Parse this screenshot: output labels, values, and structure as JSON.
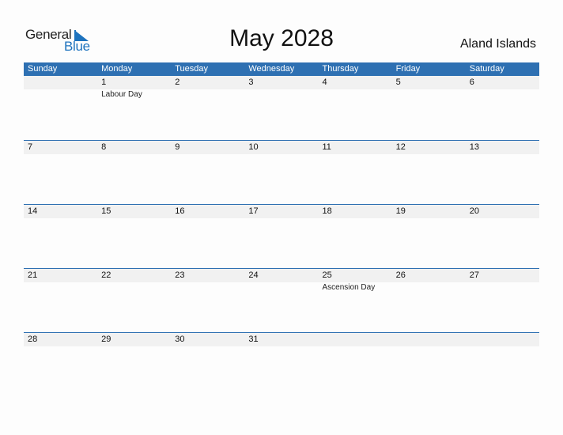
{
  "logo": {
    "general": "General",
    "blue": "Blue"
  },
  "title": "May 2028",
  "country": "Aland Islands",
  "colors": {
    "accent": "#2e70b2",
    "day_band": "#f1f1f1"
  },
  "weekdays": [
    "Sunday",
    "Monday",
    "Tuesday",
    "Wednesday",
    "Thursday",
    "Friday",
    "Saturday"
  ],
  "weeks": [
    {
      "days": [
        "",
        "1",
        "2",
        "3",
        "4",
        "5",
        "6"
      ],
      "events": [
        "",
        "Labour Day",
        "",
        "",
        "",
        "",
        ""
      ]
    },
    {
      "days": [
        "7",
        "8",
        "9",
        "10",
        "11",
        "12",
        "13"
      ],
      "events": [
        "",
        "",
        "",
        "",
        "",
        "",
        ""
      ]
    },
    {
      "days": [
        "14",
        "15",
        "16",
        "17",
        "18",
        "19",
        "20"
      ],
      "events": [
        "",
        "",
        "",
        "",
        "",
        "",
        ""
      ]
    },
    {
      "days": [
        "21",
        "22",
        "23",
        "24",
        "25",
        "26",
        "27"
      ],
      "events": [
        "",
        "",
        "",
        "",
        "Ascension Day",
        "",
        ""
      ]
    },
    {
      "days": [
        "28",
        "29",
        "30",
        "31",
        "",
        "",
        ""
      ],
      "events": [
        "",
        "",
        "",
        "",
        "",
        "",
        ""
      ]
    }
  ]
}
